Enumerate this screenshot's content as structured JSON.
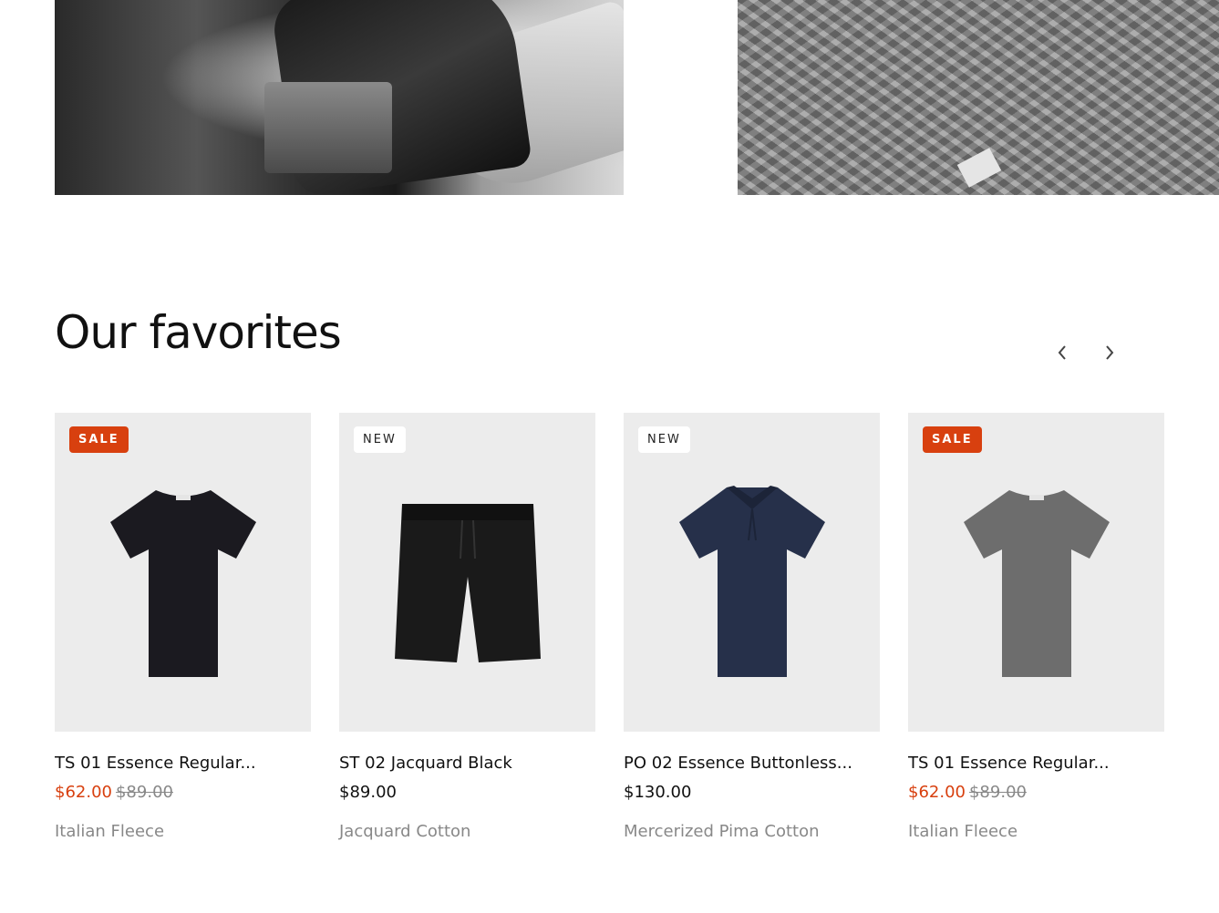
{
  "colors": {
    "accent": "#d8400f",
    "media_bg": "#ececec",
    "muted_text": "#888888"
  },
  "section": {
    "title": "Our favorites",
    "prev_icon": "chevron-left-icon",
    "next_icon": "chevron-right-icon"
  },
  "products": [
    {
      "badge": "SALE",
      "badge_type": "sale",
      "title": "TS 01 Essence Regular...",
      "price": "$62.00",
      "compare_price": "$89.00",
      "material": "Italian Fleece",
      "garment": "tshirt",
      "garment_color": "#1b1a20"
    },
    {
      "badge": "NEW",
      "badge_type": "new",
      "title": "ST 02 Jacquard Black",
      "price": "$89.00",
      "compare_price": "",
      "material": "Jacquard Cotton",
      "garment": "shorts",
      "garment_color": "#1a1a1a"
    },
    {
      "badge": "NEW",
      "badge_type": "new",
      "title": "PO 02 Essence Buttonless...",
      "price": "$130.00",
      "compare_price": "",
      "material": "Mercerized Pima Cotton",
      "garment": "polo",
      "garment_color": "#26304a"
    },
    {
      "badge": "SALE",
      "badge_type": "sale",
      "title": "TS 01 Essence Regular...",
      "price": "$62.00",
      "compare_price": "$89.00",
      "material": "Italian Fleece",
      "garment": "tshirt",
      "garment_color": "#6d6d6d"
    }
  ]
}
